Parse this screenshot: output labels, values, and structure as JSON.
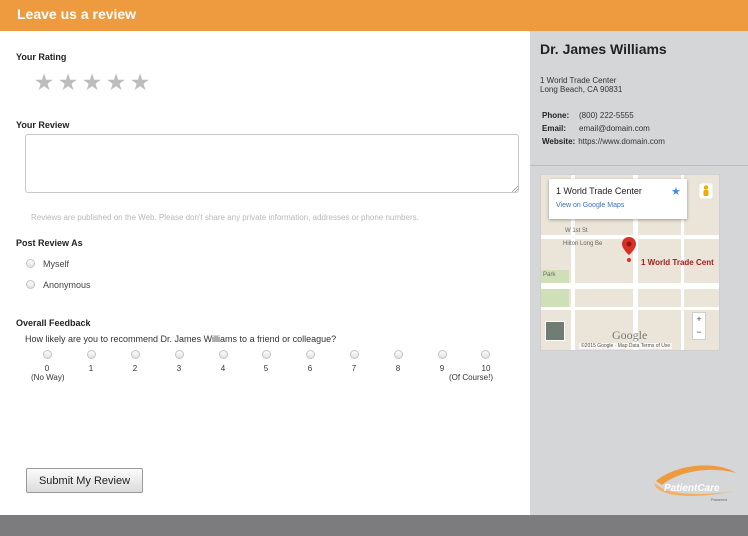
{
  "header": {
    "title": "Leave us a review"
  },
  "form": {
    "rating_label": "Your Rating",
    "stars": [
      "★",
      "★",
      "★",
      "★",
      "★"
    ],
    "rating_value": 0,
    "review_label": "Your Review",
    "review_value": "",
    "review_note": "Reviews are published on the Web. Please don't share any private information, addresses or phone numbers.",
    "post_as_label": "Post Review As",
    "post_as_options": [
      "Myself",
      "Anonymous"
    ],
    "feedback_label": "Overall Feedback",
    "feedback_question": "How likely are you to recommend Dr. James Williams to a friend or colleague?",
    "scale": [
      "0",
      "1",
      "2",
      "3",
      "4",
      "5",
      "6",
      "7",
      "8",
      "9",
      "10"
    ],
    "scale_low_note": "(No Way)",
    "scale_high_note": "(Of Course!)",
    "submit_label": "Submit My Review"
  },
  "doctor": {
    "name": "Dr. James Williams",
    "address_line1": "1 World Trade Center",
    "address_line2": "Long Beach, CA 90831",
    "phone_key": "Phone:",
    "phone": "(800) 222-5555",
    "email_key": "Email:",
    "email": "email@domain.com",
    "website_key": "Website:",
    "website": "https://www.domain.com"
  },
  "map": {
    "popup_title": "1 World Trade Center",
    "popup_link": "View on Google Maps",
    "pin_label": "1 World Trade Cent",
    "street_label": "W 1st St",
    "place_label": "Hilton Long Be",
    "park_label": "Park",
    "google_logo": "Google",
    "attribution": "©2015 Google · Map Data    Terms of Use",
    "zoom_in": "+",
    "zoom_out": "−"
  },
  "brand": {
    "name": "PatientCare",
    "sub": "Powered"
  },
  "colors": {
    "accent": "#ee9a3f",
    "sidebar_bg": "#d5d6d8",
    "footer_bg": "#7c7c7e",
    "star_empty": "#bdbdbd",
    "pin": "#d93025",
    "link": "#3a6fc4"
  },
  "icons": {
    "rating": "star-icon",
    "map_pin": "map-pin-icon",
    "popup_save": "star-icon",
    "street_view": "pegman-icon",
    "resize": "resize-grip-icon"
  }
}
